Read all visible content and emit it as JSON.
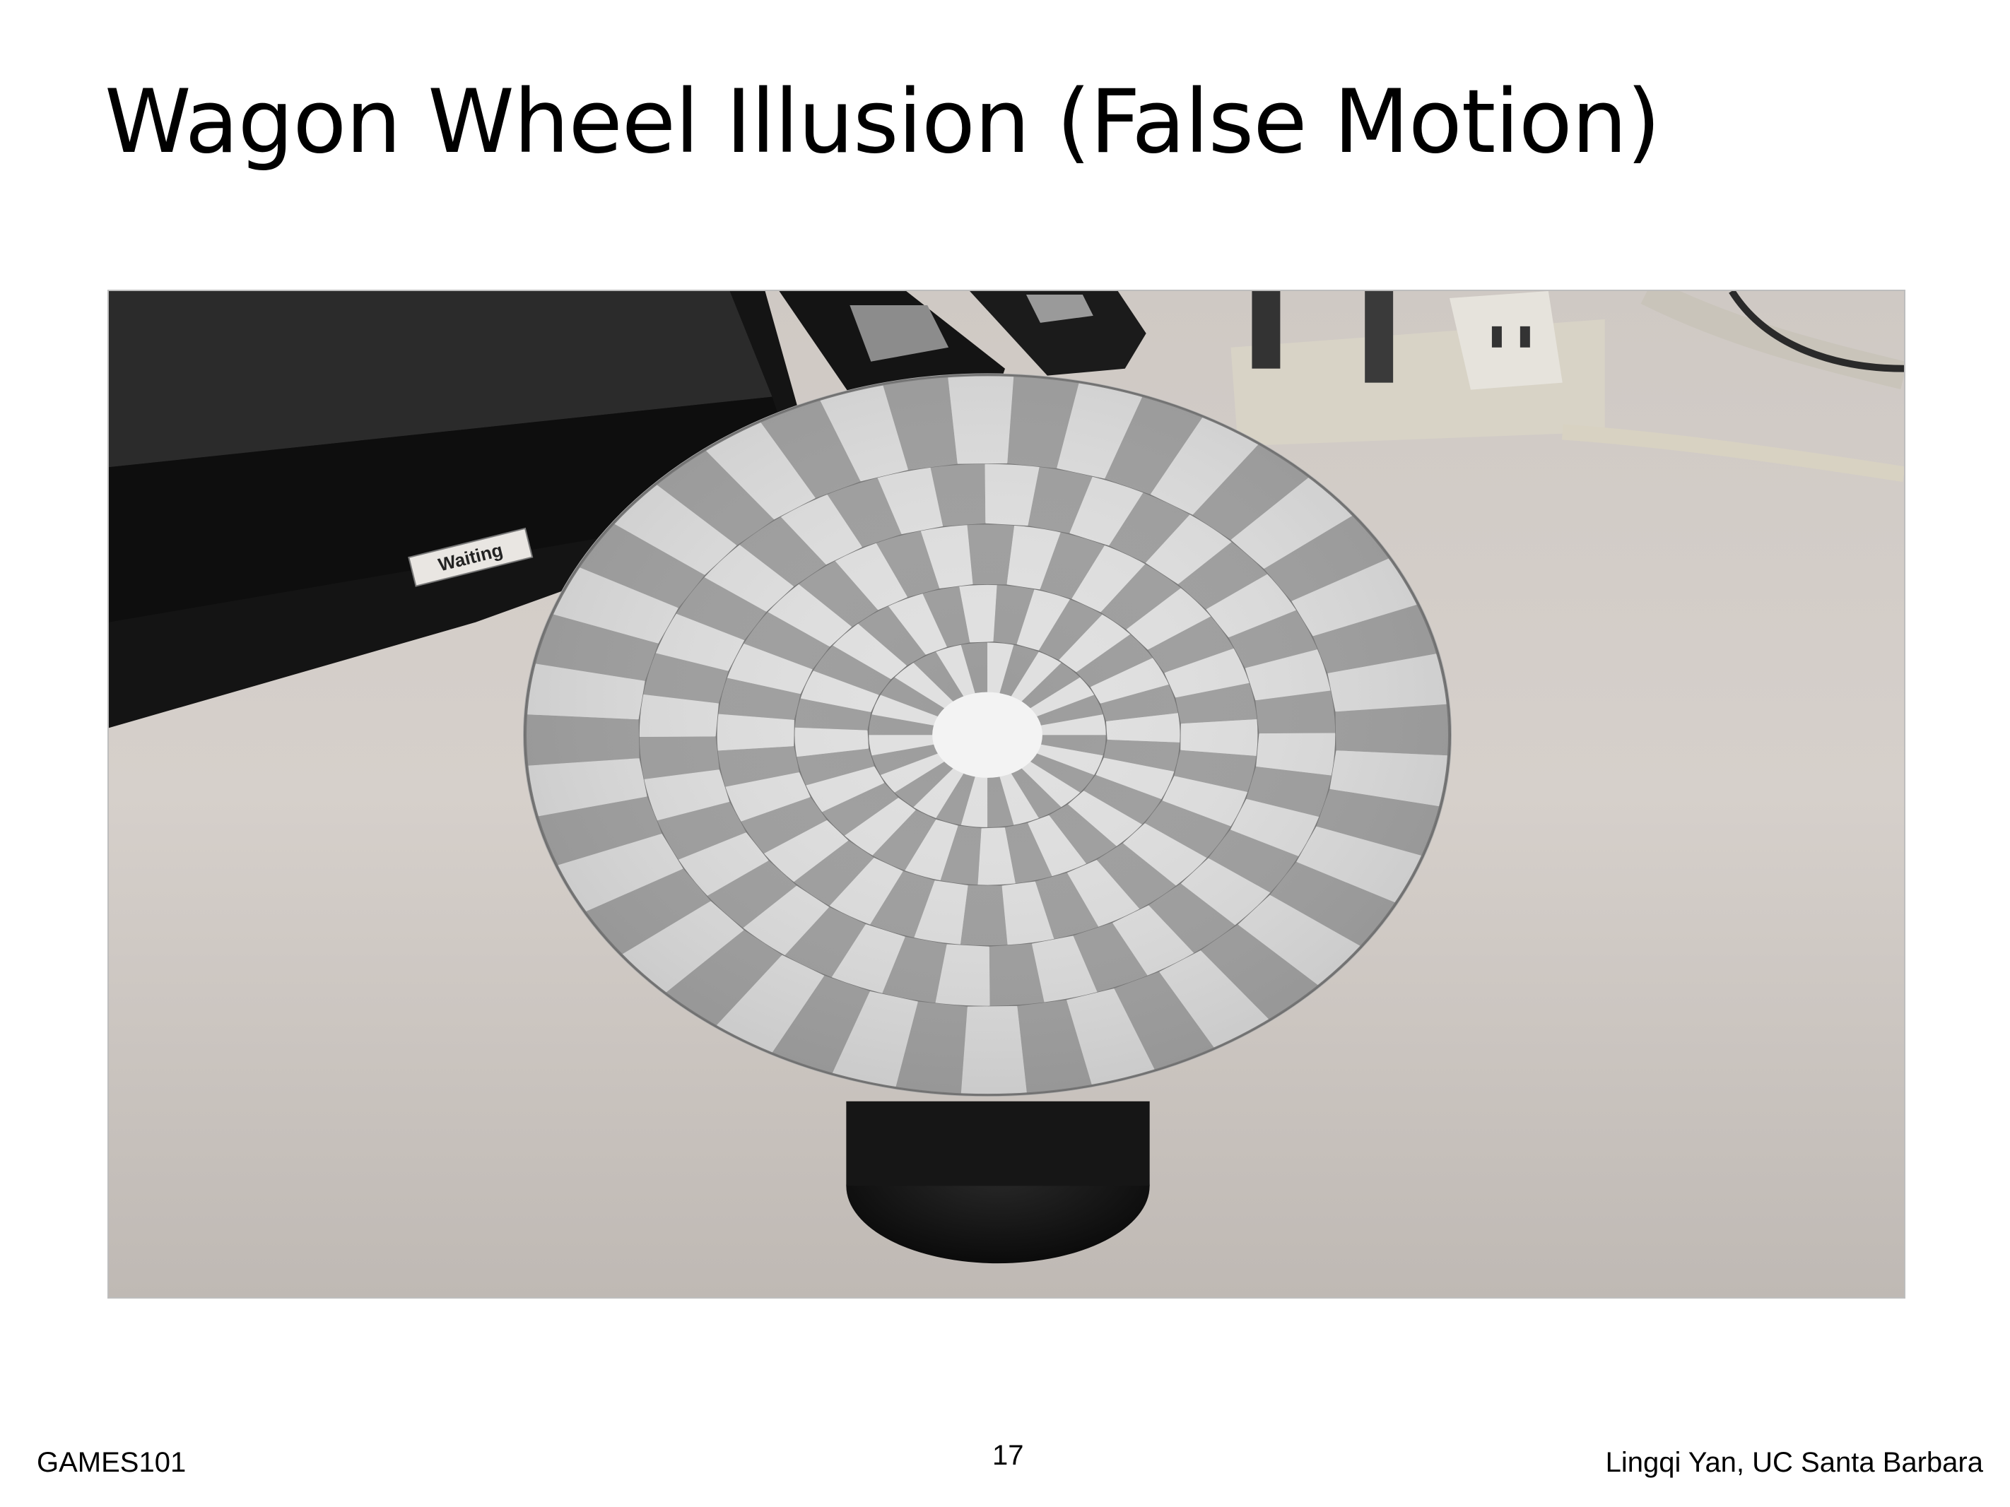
{
  "slide": {
    "title": "Wagon Wheel Illusion (False Motion)"
  },
  "photo": {
    "label_sticker": "Waiting"
  },
  "footer": {
    "left": "GAMES101",
    "page_number": "17",
    "right": "Lingqi Yan, UC Santa Barbara"
  }
}
